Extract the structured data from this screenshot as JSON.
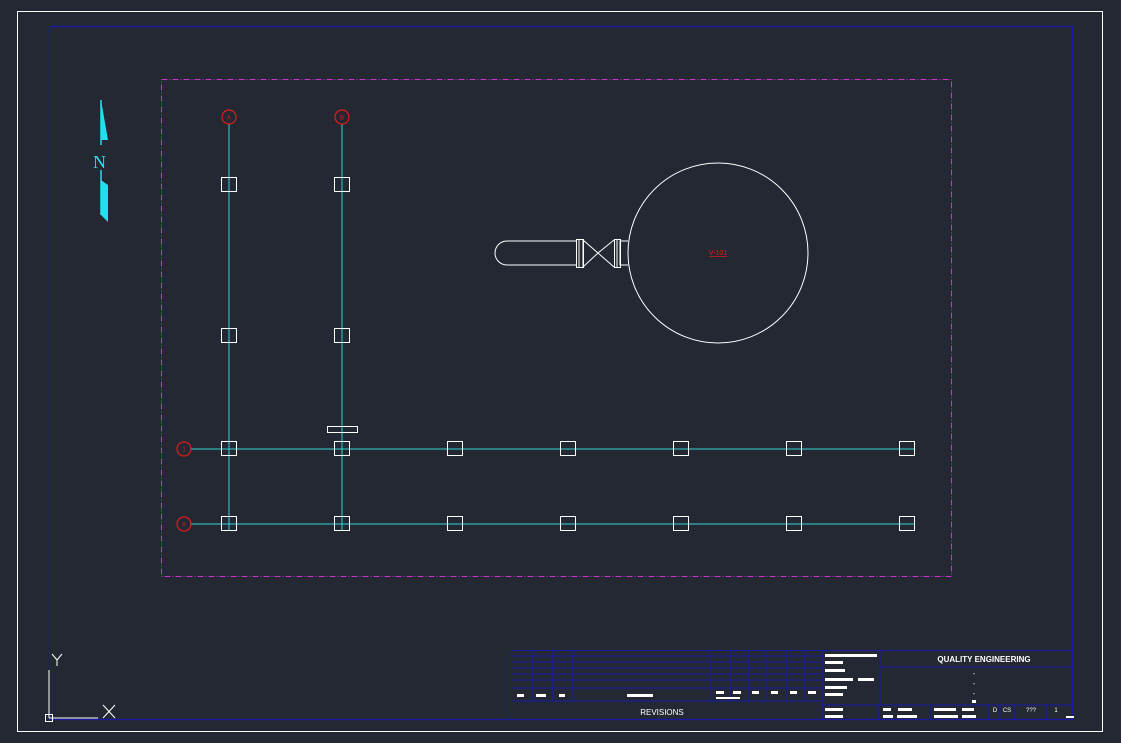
{
  "drawing": {
    "colors": {
      "background": "#232832",
      "sheet_border": "#ffffff",
      "inner_border": "#1a1aa8",
      "viewport": "#cc33cc",
      "grid_lines": "#33d6d6",
      "grid_bubble": "#e01b1b",
      "column": "#ffffff",
      "north_arrow": "#20e0f0",
      "title_block": "#1a1aa8",
      "tag_text": "#e01b1b"
    },
    "grid_bubbles_vertical": [
      {
        "label": "A"
      },
      {
        "label": "B"
      }
    ],
    "grid_bubbles_horizontal": [
      {
        "label": "1"
      },
      {
        "label": "A"
      }
    ],
    "equipment_tag": "V-101",
    "north_arrow_label": "N",
    "ucs": {
      "x_label": "X",
      "y_label": "Y",
      "icon": "ucs-icon"
    }
  },
  "title_block": {
    "company": "QUALITY ENGINEERING",
    "revisions_label": "REVISIONS",
    "dashes": [
      "-",
      "-",
      "-",
      "-"
    ],
    "cells": {
      "d": "D",
      "cs": "CS",
      "qmarks": "???",
      "sheet": "1"
    }
  }
}
